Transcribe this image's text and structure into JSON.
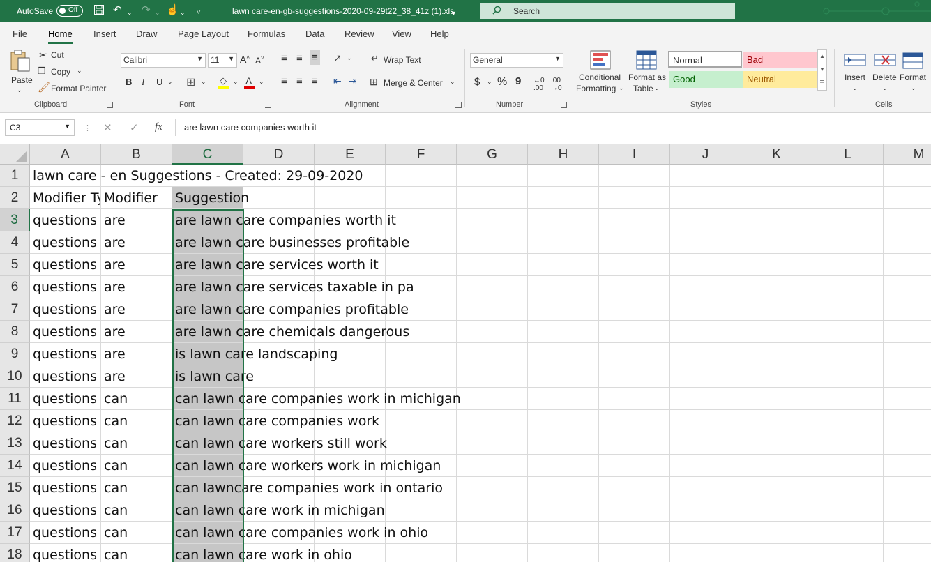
{
  "titlebar": {
    "autosave_label": "AutoSave",
    "autosave_state": "Off",
    "doc_title": "lawn care-en-gb-suggestions-2020-09-29t22_38_41z (1).xls",
    "search_placeholder": "Search"
  },
  "ribbon_tabs": [
    "File",
    "Home",
    "Insert",
    "Draw",
    "Page Layout",
    "Formulas",
    "Data",
    "Review",
    "View",
    "Help"
  ],
  "ribbon": {
    "clipboard": {
      "paste": "Paste",
      "cut": "Cut",
      "copy": "Copy",
      "format_painter": "Format Painter",
      "label": "Clipboard"
    },
    "font": {
      "name": "Calibri",
      "size": "11",
      "label": "Font",
      "bold": "B",
      "italic": "I",
      "underline": "U"
    },
    "alignment": {
      "wrap_text": "Wrap Text",
      "merge_center": "Merge & Center",
      "label": "Alignment"
    },
    "number": {
      "format": "General",
      "label": "Number",
      "currency": "$",
      "percent": "%",
      "comma": "9"
    },
    "styles": {
      "conditional_formatting_1": "Conditional",
      "conditional_formatting_2": "Formatting",
      "format_as_table_1": "Format as",
      "format_as_table_2": "Table",
      "normal": "Normal",
      "bad": "Bad",
      "good": "Good",
      "neutral": "Neutral",
      "label": "Styles"
    },
    "cells": {
      "insert": "Insert",
      "delete": "Delete",
      "format": "Format",
      "label": "Cells"
    }
  },
  "formula_bar": {
    "name_box": "C3",
    "fx": "fx",
    "content": "are lawn care companies worth it"
  },
  "columns": [
    "A",
    "B",
    "C",
    "D",
    "E",
    "F",
    "G",
    "H",
    "I",
    "J",
    "K",
    "L",
    "M"
  ],
  "selected_column": "C",
  "selected_cell": "C3",
  "sheet": {
    "row1_title": "lawn care - en Suggestions - Created: 29-09-2020",
    "headers": [
      "Modifier Type",
      "Modifier",
      "Suggestion"
    ],
    "rows": [
      [
        "questions",
        "are",
        "are lawn care companies worth it"
      ],
      [
        "questions",
        "are",
        "are lawn care businesses profitable"
      ],
      [
        "questions",
        "are",
        "are lawn care services worth it"
      ],
      [
        "questions",
        "are",
        "are lawn care services taxable in pa"
      ],
      [
        "questions",
        "are",
        "are lawn care companies profitable"
      ],
      [
        "questions",
        "are",
        "are lawn care chemicals dangerous"
      ],
      [
        "questions",
        "are",
        "is lawn care landscaping"
      ],
      [
        "questions",
        "are",
        "is lawn care"
      ],
      [
        "questions",
        "can",
        "can lawn care companies work in michigan"
      ],
      [
        "questions",
        "can",
        "can lawn care companies work"
      ],
      [
        "questions",
        "can",
        "can lawn care workers still work"
      ],
      [
        "questions",
        "can",
        "can lawn care workers work in michigan"
      ],
      [
        "questions",
        "can",
        "can lawncare companies work in ontario"
      ],
      [
        "questions",
        "can",
        "can lawn care work in michigan"
      ],
      [
        "questions",
        "can",
        "can lawn care companies work in ohio"
      ],
      [
        "questions",
        "can",
        "can lawn care work in ohio"
      ]
    ],
    "row_numbers": [
      "1",
      "2",
      "3",
      "4",
      "5",
      "6",
      "7",
      "8",
      "9",
      "10",
      "11",
      "12",
      "13",
      "14",
      "15",
      "16",
      "17",
      "18"
    ]
  },
  "colors": {
    "accent": "#217346",
    "bad_bg": "#ffc7ce",
    "good_bg": "#c6efce",
    "neutral_bg": "#ffeb9c"
  }
}
